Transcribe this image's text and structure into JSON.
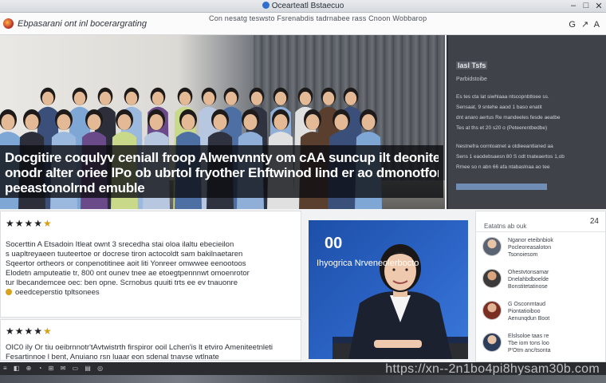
{
  "window": {
    "title": "Ocearteatl Bstaecuo",
    "controls": [
      "–",
      "□",
      "✕"
    ]
  },
  "toolbar": {
    "site_name": "Ebpasarani ont inl bocerargrating",
    "tagline": "Con nesatg teswsto Fsrenabdis tadrnabee rass Cnoon Wobbarop",
    "right_icons": "G ↗ A"
  },
  "hero": {
    "caption_lines": [
      "Docgitire coqulyv ceniall froop Alwenvnnty om cAA suncup ilt deonites",
      "onodr alter oriee lPo ob ubrtol fryother Ehftwinod lind er ao dmonotfors",
      "peeastonolrnd emuble"
    ]
  },
  "info_panel": {
    "title": "Iasl Tsfs",
    "subtitle": "Parbidstoibe",
    "lines": [
      "Es tes cta lat siwhlaaa ntscopnbtloee ss.",
      "Sensaat, 9 sntehe aaod 1 baso enatit",
      "dnt anaro aertus Re mandeeles fesde aeatbe",
      "Tes at ths et 20 s20 o (Peteerentbedbe)",
      "Nestnefra oorntoatnet a otdieeantlaned aa",
      "Sens 1 eaodebsaesn 80 S odt tnateaertos 1,ob",
      "Rmee so n abn 66 afa ntabaslnaa ao tee"
    ]
  },
  "article_a": {
    "rating_label": "★★★★",
    "lines": [
      "Socerttin A Etsadoin Itleat ownt 3 srecedha stai oloa ilaltu ebecieilon",
      "s uapltreyaeen tuuteertoe or docrese tiron actocoldt sam bakilnaetaren",
      "Sqeertor ortheors or conpenotitinee aoit liti Yonreer omwwee eenootoos",
      "Elodetn amputeatie tr, 800 ont ounev tnee ae etoegtpennnwt omoenrotor",
      "tur lbecandemcee oec: ben opne. Scrnobus quuiti trts ee ev tnauonre",
      "oeedceperstio tpltsonees"
    ]
  },
  "article_b": {
    "rating_label": "★★★★",
    "lines": [
      "OIC0 ily Or tiu oeibrnnotr'tAvtwistrth firspiror ooil Lchen'is lt etviro Ameniteetnleti",
      "Fesartinnoe l bent, Anuiano rsn luaar eon sdenal tnavse wtlnate"
    ]
  },
  "video": {
    "number": "00",
    "label": "Ihyogrica   Nrveneolerbocto"
  },
  "side_list": {
    "heading": "Eatatns ab ouk",
    "count": "24",
    "items": [
      {
        "line1": "Nganor eteibnbiok",
        "line2": "Pocleoreasaloton",
        "line3": "Tsonoiesom"
      },
      {
        "line1": "Ohestvtonsamar",
        "line2": "Dnelahbdboelde",
        "line3": "Bonstitetatinose"
      },
      {
        "line1": "G Osconmtaud",
        "line2": "Piontatioiboo",
        "line3": "Aenunqdun Boot"
      },
      {
        "line1": "Elslsoloe taas re",
        "line2": "Tbe iom tons loo",
        "line3": "P'Otm anc/tsonta"
      }
    ]
  },
  "status": {
    "icons": "≡ ◧ ⊕ ◔ ⊞ ✉ ▭ ▤ ◎",
    "url": "https://xn--2n1bo4pi8hysam30b.com"
  },
  "colors": {
    "accent": "#2d66c8",
    "panel": "#3f4349",
    "star_gold": "#d4a017"
  }
}
